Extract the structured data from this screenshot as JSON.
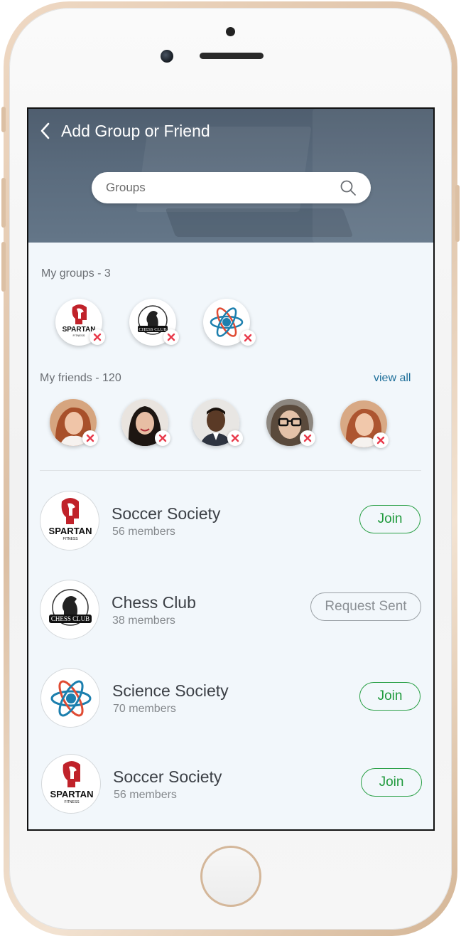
{
  "header": {
    "title": "Add Group or Friend",
    "search_placeholder": "Groups"
  },
  "my_groups": {
    "label": "My groups - 3",
    "items": [
      {
        "logo": "spartan-fitness-logo",
        "logo_text": "SPARTAN",
        "logo_sub": "FITNESS"
      },
      {
        "logo": "chess-club-logo",
        "logo_text": "CHESS CLUB"
      },
      {
        "logo": "science-atom-logo"
      }
    ]
  },
  "my_friends": {
    "label": "My friends - 120",
    "view_all_label": "view all",
    "avatars": [
      "friend-avatar-red-hair",
      "friend-avatar-dark-hair",
      "friend-avatar-man",
      "friend-avatar-glasses",
      "friend-avatar-red-hair-2"
    ]
  },
  "group_list": [
    {
      "name": "Soccer Society",
      "members": "56 members",
      "action": "Join",
      "logo": "spartan-fitness-logo",
      "logo_text": "SPARTAN",
      "logo_sub": "FITNESS"
    },
    {
      "name": "Chess Club",
      "members": "38 members",
      "action": "Request Sent",
      "logo": "chess-club-logo",
      "logo_text": "CHESS CLUB"
    },
    {
      "name": "Science Society",
      "members": "70 members",
      "action": "Join",
      "logo": "science-atom-logo"
    },
    {
      "name": "Soccer Society",
      "members": "56 members",
      "action": "Join",
      "logo": "spartan-fitness-logo",
      "logo_text": "SPARTAN",
      "logo_sub": "FITNESS"
    }
  ],
  "colors": {
    "header_bg": "#5a6b7d",
    "join_green": "#1f9a3c",
    "link_blue": "#1f6f9a",
    "remove_red": "#e8394a",
    "screen_bg": "#f2f7fb"
  }
}
